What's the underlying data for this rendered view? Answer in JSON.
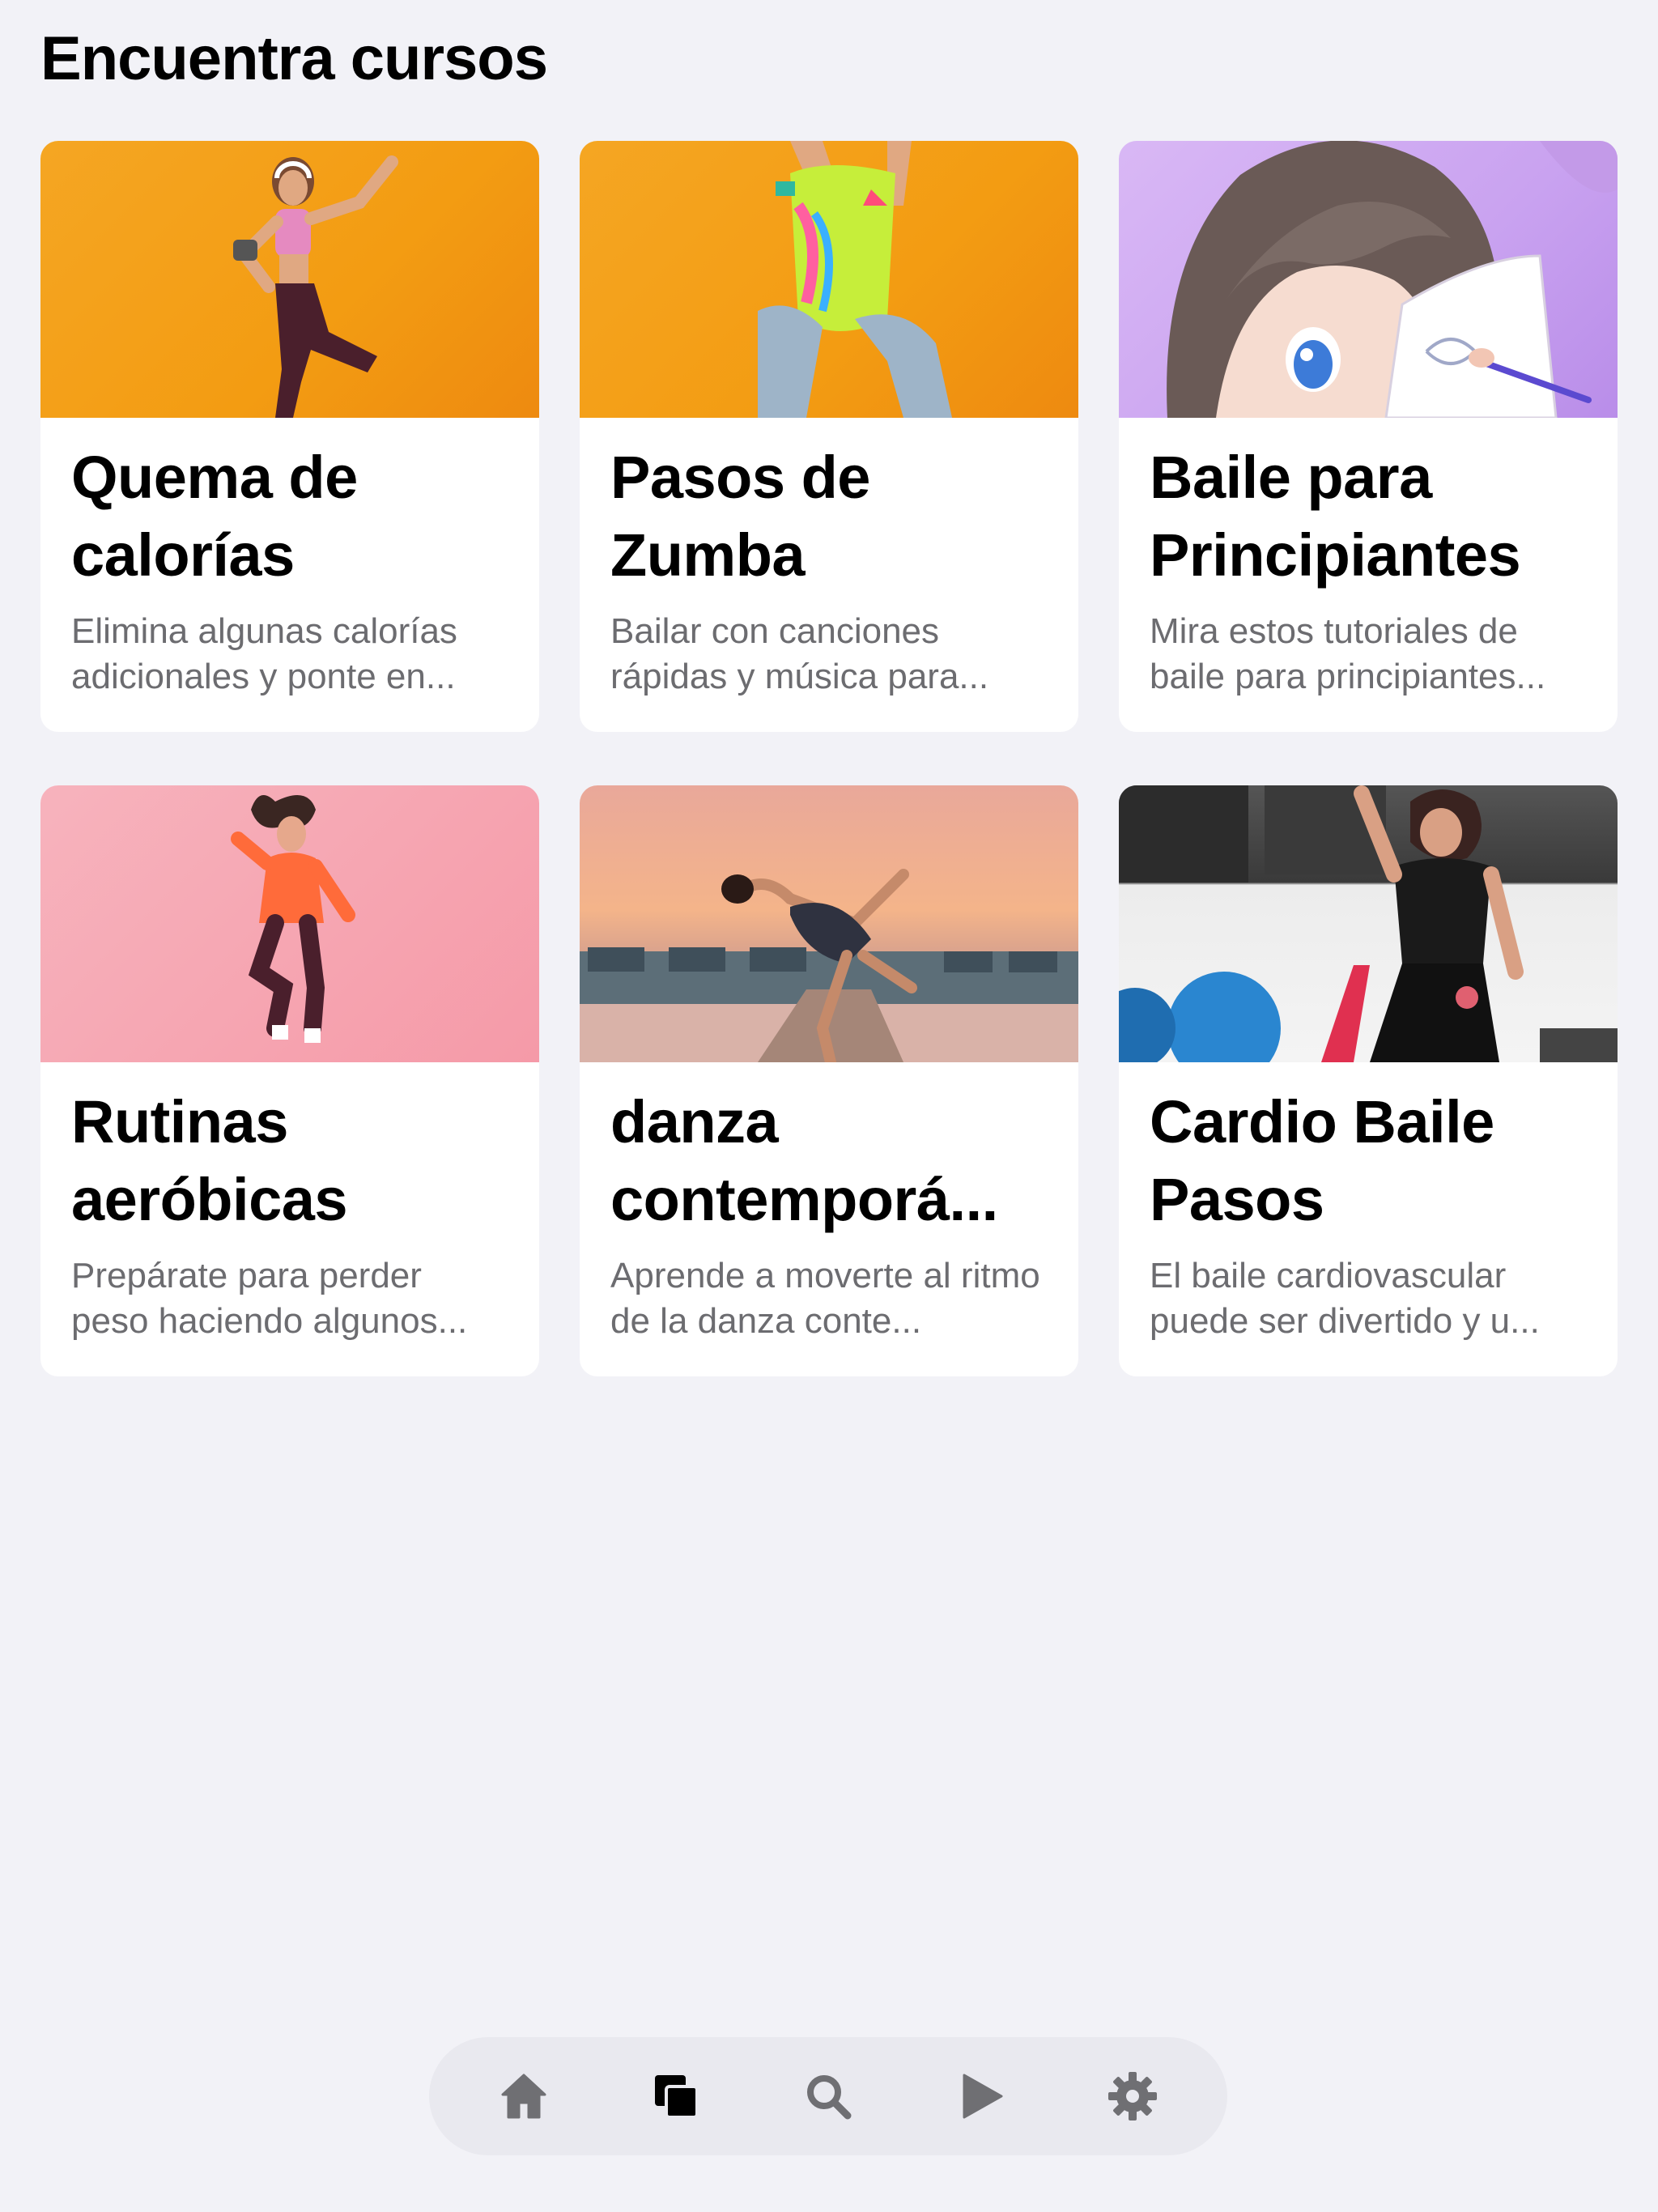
{
  "header": {
    "title": "Encuentra cursos"
  },
  "courses": [
    {
      "title": "Quema de calorías",
      "description": "Elimina algunas calorías adicionales y ponte en...",
      "image": "woman-fitness-orange-background"
    },
    {
      "title": "Pasos de Zumba",
      "description": "Bailar con canciones rápidas y música para...",
      "image": "zumba-leotard-orange-background"
    },
    {
      "title": "Baile para Principiantes",
      "description": "Mira estos tutoriales de baile para principiantes...",
      "image": "anime-girl-drawing-purple-background"
    },
    {
      "title": "Rutinas aeróbicas",
      "description": "Prepárate para perder peso haciendo algunos...",
      "image": "woman-jumping-pink-background"
    },
    {
      "title": "danza contemporá...",
      "description": "Aprende a moverte al ritmo de la danza conte...",
      "image": "dancer-pier-sunset"
    },
    {
      "title": "Cardio Baile Pasos",
      "description": "El baile cardiovascular puede ser divertido y u...",
      "image": "woman-gym-dumbbells"
    }
  ],
  "tabbar": {
    "items": [
      {
        "icon": "house-icon",
        "active": false
      },
      {
        "icon": "courses-icon",
        "active": true
      },
      {
        "icon": "search-icon",
        "active": false
      },
      {
        "icon": "play-icon",
        "active": false
      },
      {
        "icon": "gear-icon",
        "active": false
      }
    ],
    "colors": {
      "active": "#000000",
      "inactive": "#6f6f73"
    }
  }
}
